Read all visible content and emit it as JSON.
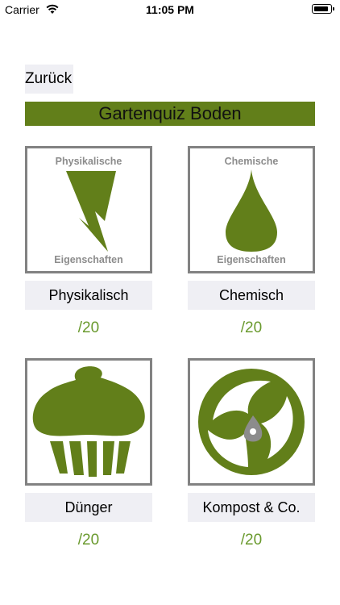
{
  "status_bar": {
    "carrier": "Carrier",
    "time": "11:05 PM"
  },
  "nav": {
    "back_label": "Zurück"
  },
  "header": {
    "title": "Gartenquiz Boden"
  },
  "categories": [
    {
      "label": "Physikalisch",
      "score": "/20",
      "icon_top_text": "Physikalische",
      "icon_bottom_text": "Eigenschaften",
      "icon": "lightning-icon"
    },
    {
      "label": "Chemisch",
      "score": "/20",
      "icon_top_text": "Chemische",
      "icon_bottom_text": "Eigenschaften",
      "icon": "droplet-icon"
    },
    {
      "label": "Dünger",
      "score": "/20",
      "icon": "cupcake-icon"
    },
    {
      "label": "Kompost & Co.",
      "score": "/20",
      "icon": "compost-cycle-icon"
    }
  ],
  "colors": {
    "accent_green": "#627f1a",
    "score_green": "#6a9a2e",
    "tile_border": "#828282",
    "button_bg": "#efeff4"
  }
}
